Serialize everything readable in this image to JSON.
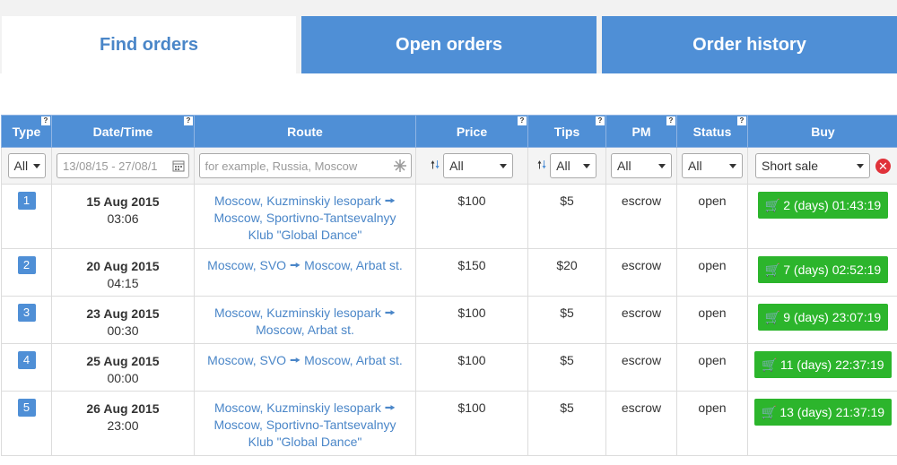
{
  "tabs": [
    {
      "label": "Find orders"
    },
    {
      "label": "Open orders"
    },
    {
      "label": "Order history"
    }
  ],
  "table": {
    "headers": [
      {
        "label": "Type",
        "help": "?"
      },
      {
        "label": "Date/Time",
        "help": "?"
      },
      {
        "label": "Route",
        "help": ""
      },
      {
        "label": "Price",
        "help": "?"
      },
      {
        "label": "Tips",
        "help": "?"
      },
      {
        "label": "PM",
        "help": "?"
      },
      {
        "label": "Status",
        "help": "?"
      },
      {
        "label": "Buy",
        "help": ""
      }
    ],
    "filters": {
      "type": "All",
      "date_value": "13/08/15 - 27/08/1",
      "route_placeholder": "for example, Russia, Moscow",
      "price": "All",
      "tips": "All",
      "pm": "All",
      "status": "All",
      "buy": "Short sale"
    },
    "rows": [
      {
        "num": "1",
        "date": "15 Aug 2015",
        "time": "03:06",
        "route_from": "Moscow, Kuzminskiy lesopark",
        "route_to": "Moscow, Sportivno-Tantsevalnyy Klub \"Global Dance\"",
        "price": "$100",
        "tips": "$5",
        "pm": "escrow",
        "status": "open",
        "buy": "2 (days) 01:43:19"
      },
      {
        "num": "2",
        "date": "20 Aug 2015",
        "time": "04:15",
        "route_from": "Moscow, SVO",
        "route_to": "Moscow, Arbat st.",
        "price": "$150",
        "tips": "$20",
        "pm": "escrow",
        "status": "open",
        "buy": "7 (days) 02:52:19"
      },
      {
        "num": "3",
        "date": "23 Aug 2015",
        "time": "00:30",
        "route_from": "Moscow, Kuzminskiy lesopark",
        "route_to": "Moscow, Arbat st.",
        "price": "$100",
        "tips": "$5",
        "pm": "escrow",
        "status": "open",
        "buy": "9 (days) 23:07:19"
      },
      {
        "num": "4",
        "date": "25 Aug 2015",
        "time": "00:00",
        "route_from": "Moscow, SVO",
        "route_to": "Moscow, Arbat st.",
        "price": "$100",
        "tips": "$5",
        "pm": "escrow",
        "status": "open",
        "buy": "11 (days) 22:37:19"
      },
      {
        "num": "5",
        "date": "26 Aug 2015",
        "time": "23:00",
        "route_from": "Moscow, Kuzminskiy lesopark",
        "route_to": "Moscow, Sportivno-Tantsevalnyy Klub \"Global Dance\"",
        "price": "$100",
        "tips": "$5",
        "pm": "escrow",
        "status": "open",
        "buy": "13 (days) 21:37:19"
      }
    ]
  },
  "icons": {
    "calendar": "calendar-icon",
    "clear_input": "clear-input-icon",
    "sort": "sort-arrows-icon",
    "cart": "cart-icon",
    "clear_filters": "clear-filters-icon",
    "route_arrow": "arrow-right-icon"
  },
  "colors": {
    "tab_blue": "#4f8fd6",
    "link_blue": "#4a86c8",
    "buy_green": "#2cb52c",
    "clear_red": "#e0323a"
  }
}
